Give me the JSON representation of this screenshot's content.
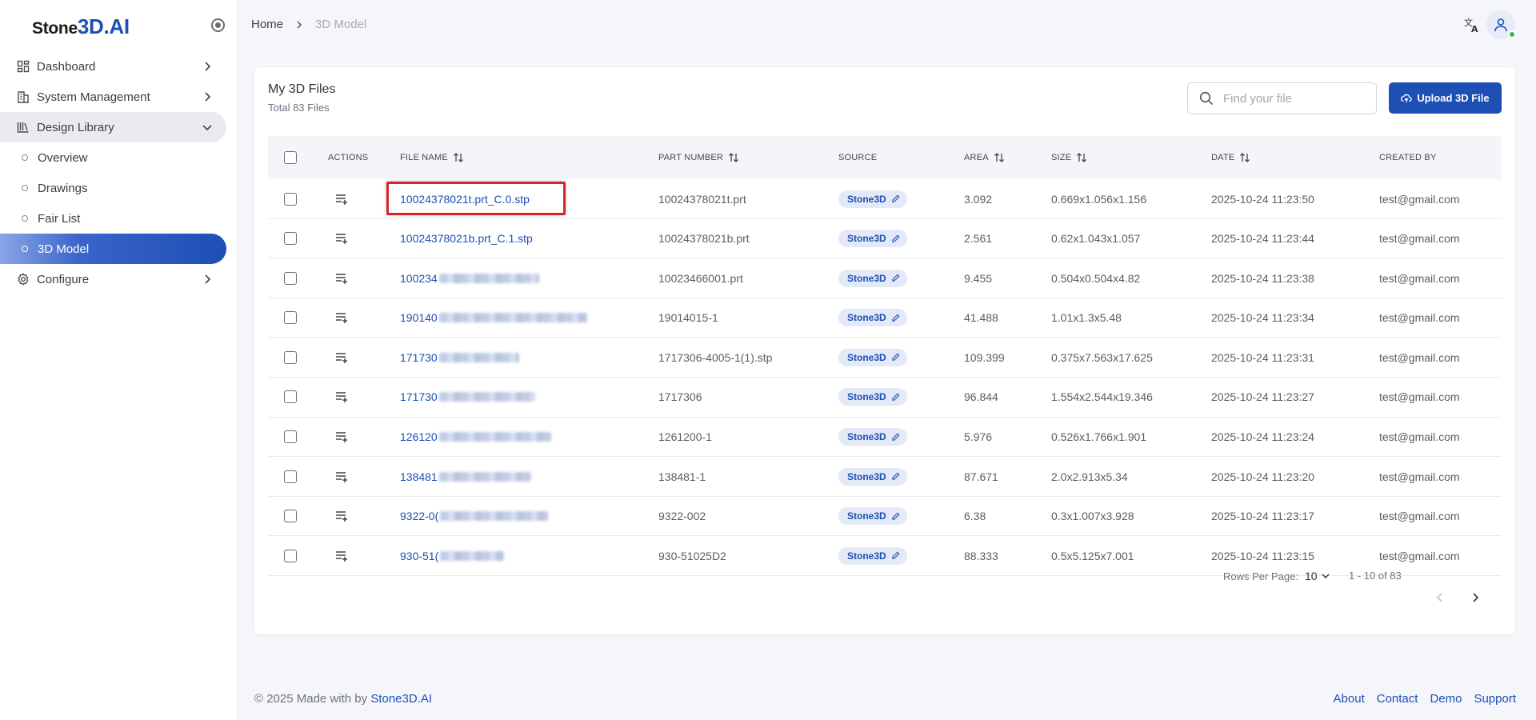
{
  "brand": {
    "part1": "Stone",
    "part2": "3D.AI"
  },
  "sidebar": {
    "items": [
      {
        "label": "Dashboard",
        "icon": "dashboard-icon"
      },
      {
        "label": "System Management",
        "icon": "building-icon"
      },
      {
        "label": "Design Library",
        "icon": "library-icon"
      },
      {
        "label": "Configure",
        "icon": "gear-icon"
      }
    ],
    "subitems": [
      {
        "label": "Overview"
      },
      {
        "label": "Drawings"
      },
      {
        "label": "Fair List"
      },
      {
        "label": "3D Model"
      }
    ]
  },
  "breadcrumb": {
    "home": "Home",
    "current": "3D Model"
  },
  "card": {
    "title": "My 3D Files",
    "subtitle": "Total 83 Files",
    "search_placeholder": "Find your file",
    "upload_label": "Upload 3D File"
  },
  "table": {
    "headers": {
      "actions": "ACTIONS",
      "file_name": "FILE NAME",
      "part_number": "PART NUMBER",
      "source": "SOURCE",
      "area": "AREA",
      "size": "SIZE",
      "date": "DATE",
      "created_by": "CREATED BY"
    },
    "rows": [
      {
        "file_name": "10024378021t.prt_C.0.stp",
        "part_number": "10024378021t.prt",
        "source": "Stone3D",
        "area": "3.092",
        "size": "0.669x1.056x1.156",
        "date": "2025-10-24 11:23:50",
        "created_by": "test@gmail.com"
      },
      {
        "file_name": "10024378021b.prt_C.1.stp",
        "part_number": "10024378021b.prt",
        "source": "Stone3D",
        "area": "2.561",
        "size": "0.62x1.043x1.057",
        "date": "2025-10-24 11:23:44",
        "created_by": "test@gmail.com"
      },
      {
        "file_name": "100234",
        "part_number": "10023466001.prt",
        "source": "Stone3D",
        "area": "9.455",
        "size": "0.504x0.504x4.82",
        "date": "2025-10-24 11:23:38",
        "created_by": "test@gmail.com"
      },
      {
        "file_name": "190140",
        "part_number": "19014015-1",
        "source": "Stone3D",
        "area": "41.488",
        "size": "1.01x1.3x5.48",
        "date": "2025-10-24 11:23:34",
        "created_by": "test@gmail.com"
      },
      {
        "file_name": "171730",
        "part_number": "1717306-4005-1(1).stp",
        "source": "Stone3D",
        "area": "109.399",
        "size": "0.375x7.563x17.625",
        "date": "2025-10-24 11:23:31",
        "created_by": "test@gmail.com"
      },
      {
        "file_name": "171730",
        "part_number": "1717306",
        "source": "Stone3D",
        "area": "96.844",
        "size": "1.554x2.544x19.346",
        "date": "2025-10-24 11:23:27",
        "created_by": "test@gmail.com"
      },
      {
        "file_name": "126120",
        "part_number": "1261200-1",
        "source": "Stone3D",
        "area": "5.976",
        "size": "0.526x1.766x1.901",
        "date": "2025-10-24 11:23:24",
        "created_by": "test@gmail.com"
      },
      {
        "file_name": "138481",
        "part_number": "138481-1",
        "source": "Stone3D",
        "area": "87.671",
        "size": "2.0x2.913x5.34",
        "date": "2025-10-24 11:23:20",
        "created_by": "test@gmail.com"
      },
      {
        "file_name": "9322-0(",
        "part_number": "9322-002",
        "source": "Stone3D",
        "area": "6.38",
        "size": "0.3x1.007x3.928",
        "date": "2025-10-24 11:23:17",
        "created_by": "test@gmail.com"
      },
      {
        "file_name": "930-51(",
        "part_number": "930-51025D2",
        "source": "Stone3D",
        "area": "88.333",
        "size": "0.5x5.125x7.001",
        "date": "2025-10-24 11:23:15",
        "created_by": "test@gmail.com"
      }
    ]
  },
  "pagination": {
    "rows_per_page_label": "Rows Per Page:",
    "rows_per_page": "10",
    "range": "1 - 10 of 83"
  },
  "footer": {
    "copyright": "© 2025 Made with by ",
    "brand": "Stone3D.AI",
    "links": [
      "About",
      "Contact",
      "Demo",
      "Support"
    ]
  },
  "colors": {
    "accent": "#1d4fb5",
    "highlight": "#d7232a",
    "online": "#3bb54a"
  }
}
